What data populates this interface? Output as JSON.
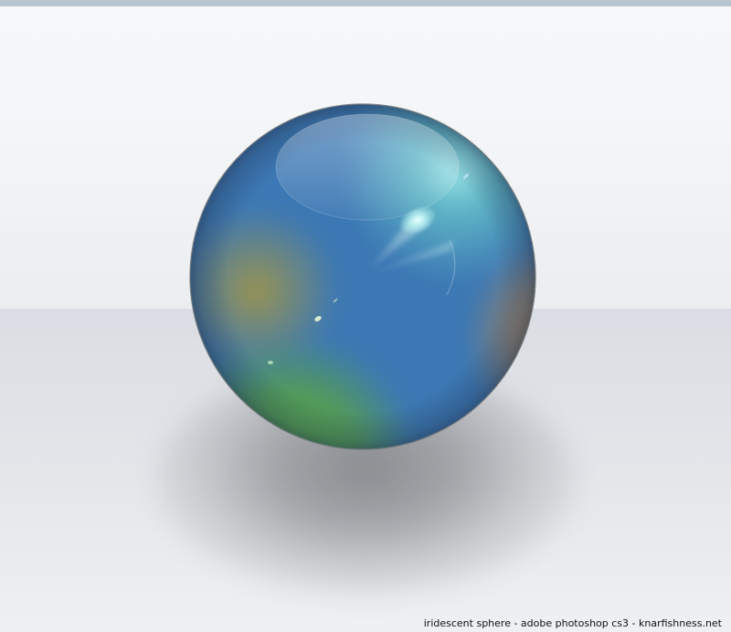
{
  "caption": "iridescent sphere - adobe photoshop cs3 - knarfishness.net",
  "colors": {
    "top_strip": "#b9c6d0",
    "background_upper": "#f4f6f8",
    "background_lower": "#dde0e5",
    "sphere_blue": "#3e7fb8",
    "sphere_purple": "#6a4aa0",
    "sphere_orange": "#b98a55",
    "sphere_green": "#5aa04a",
    "sphere_teal_highlight": "#8fe3e8"
  }
}
